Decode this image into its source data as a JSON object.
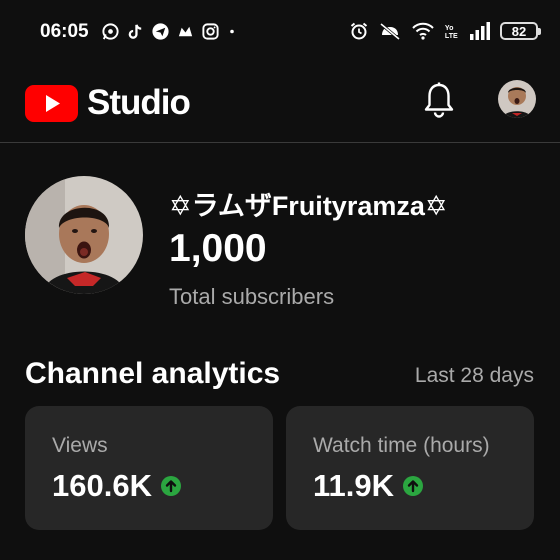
{
  "status_bar": {
    "time": "06:05",
    "app_icons": [
      "whatsapp-icon",
      "tiktok-icon",
      "telegram-icon",
      "app-icon",
      "instagram-icon",
      "more-notifications-dot"
    ],
    "system_icons": [
      "alarm-icon",
      "vibrate-icon",
      "wifi-icon",
      "volte-icon",
      "signal-icon"
    ],
    "battery": "82"
  },
  "header": {
    "brand": "Studio",
    "brand_color": "#ff0000",
    "icons": [
      "notifications-bell-icon",
      "account-avatar"
    ]
  },
  "channel": {
    "name": "✡ラムザFruityramza✡",
    "subscribers": "1,000",
    "subscribers_label": "Total subscribers"
  },
  "analytics": {
    "title": "Channel analytics",
    "range": "Last 28 days",
    "cards": [
      {
        "label": "Views",
        "value": "160.6K",
        "trend": "up"
      },
      {
        "label": "Watch time (hours)",
        "value": "11.9K",
        "trend": "up"
      }
    ],
    "trend_up_color": "#2ba640"
  }
}
